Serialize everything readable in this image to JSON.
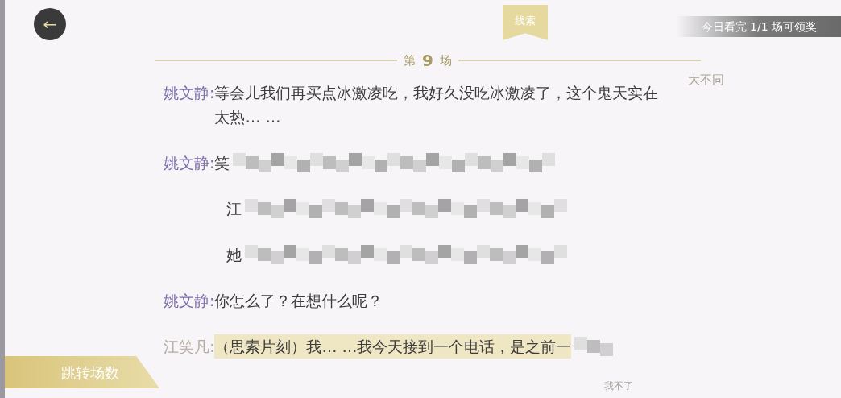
{
  "back_button": {
    "label": "←"
  },
  "clue_tab": {
    "label": "线索"
  },
  "reward_banner": {
    "text": "今日看完 1/1 场可领奖"
  },
  "scene_header": {
    "prefix": "第",
    "number": "9",
    "suffix": "场"
  },
  "side_notes": [
    "大不同",
    "我不了"
  ],
  "lines": [
    {
      "kind": "speech",
      "speaker": "姚文静:",
      "speaker_faded": false,
      "text": "等会儿我们再买点冰激凌吃，我好久没吃冰激凌了，这个鬼天实在太热… …",
      "highlighted": false,
      "redacted": false
    },
    {
      "kind": "speech",
      "speaker": "姚文静:",
      "speaker_faded": false,
      "text": "笑",
      "highlighted": false,
      "redacted": true
    },
    {
      "kind": "narration",
      "text": "江",
      "highlighted": false,
      "redacted": true
    },
    {
      "kind": "narration",
      "text": "她",
      "highlighted": false,
      "redacted": true
    },
    {
      "kind": "speech",
      "speaker": "姚文静:",
      "speaker_faded": false,
      "text": "你怎么了？在想什么呢？",
      "highlighted": false,
      "redacted": false
    },
    {
      "kind": "speech",
      "speaker": "江笑凡:",
      "speaker_faded": true,
      "text": "（思索片刻）我… …我今天接到一个电话，是之前一",
      "highlighted": true,
      "redacted": true
    }
  ],
  "jump_button": {
    "label": "跳转场数"
  }
}
